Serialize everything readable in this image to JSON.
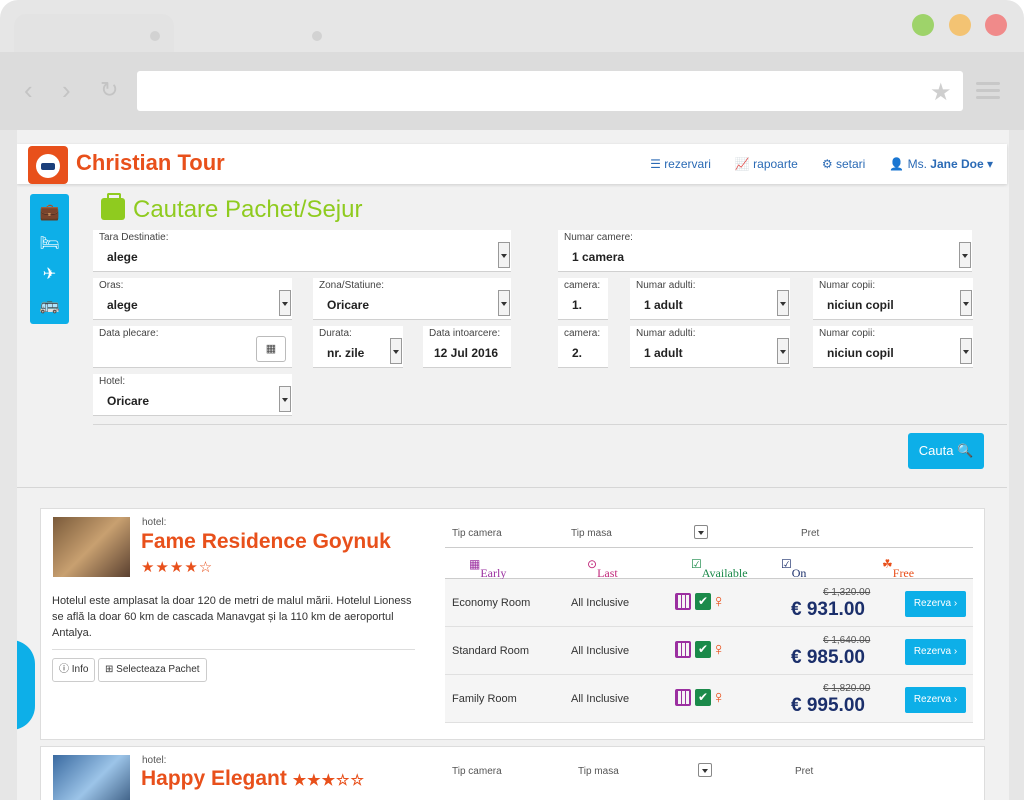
{
  "brand": {
    "name": "Christian Tour"
  },
  "nav": {
    "rezervari": "rezervari",
    "rapoarte": "rapoarte",
    "setari": "setari",
    "user_prefix": "Ms.",
    "user_name": "Jane Doe"
  },
  "search": {
    "title": "Cautare Pachet/Sejur",
    "tara_label": "Tara Destinatie:",
    "tara_value": "alege",
    "oras_label": "Oras:",
    "oras_value": "alege",
    "zona_label": "Zona/Statiune:",
    "zona_value": "Oricare",
    "data_plecare_label": "Data plecare:",
    "durata_label": "Durata:",
    "durata_value": "nr. zile",
    "data_intoarcere_label": "Data intoarcere:",
    "data_intoarcere_value": "12 Jul 2016",
    "hotel_label": "Hotel:",
    "hotel_value": "Oricare",
    "numar_camere_label": "Numar camere:",
    "numar_camere_value": "1 camera",
    "rooms": [
      {
        "camera_label": "camera:",
        "camera_value": "1.",
        "adulti_label": "Numar adulti:",
        "adulti_value": "1 adult",
        "copii_label": "Numar copii:",
        "copii_value": "niciun copil"
      },
      {
        "camera_label": "camera:",
        "camera_value": "2.",
        "adulti_label": "Numar adulti:",
        "adulti_value": "1 adult",
        "copii_label": "Numar copii:",
        "copii_value": "niciun copil"
      }
    ],
    "button_label": "Cauta"
  },
  "results": [
    {
      "hotel_label": "hotel:",
      "name": "Fame Residence Goynuk",
      "stars": "★★★★☆",
      "description": "Hotelul este amplasat la doar 120 de metri de malul mării. Hotelul Lioness se află la doar 60 km de cascada Manavgat și la 110 km de aeroportul Antalya.",
      "info_button": "Info",
      "select_button": "Selecteaza Pachet",
      "headers": {
        "tip_camera": "Tip camera",
        "tip_masa": "Tip masa",
        "pret": "Pret"
      },
      "legend": {
        "early_booking": "Early Booking",
        "last_minute": "Last Minute",
        "available": "Available",
        "on_request": "On Request",
        "free_child": "Free Child"
      },
      "rooms": [
        {
          "type": "Economy Room",
          "meal": "All Inclusive",
          "old_price": "€ 1,320.00",
          "price": "€ 931.00",
          "button": "Rezerva ›"
        },
        {
          "type": "Standard Room",
          "meal": "All Inclusive",
          "old_price": "€ 1,640.00",
          "price": "€ 985.00",
          "button": "Rezerva ›"
        },
        {
          "type": "Family Room",
          "meal": "All Inclusive",
          "old_price": "€ 1,820.00",
          "price": "€ 995.00",
          "button": "Rezerva ›"
        }
      ]
    },
    {
      "hotel_label": "hotel:",
      "name": "Happy Elegant",
      "stars": "★★★☆☆",
      "headers": {
        "tip_camera": "Tip camera",
        "tip_masa": "Tip masa",
        "pret": "Pret"
      }
    }
  ]
}
